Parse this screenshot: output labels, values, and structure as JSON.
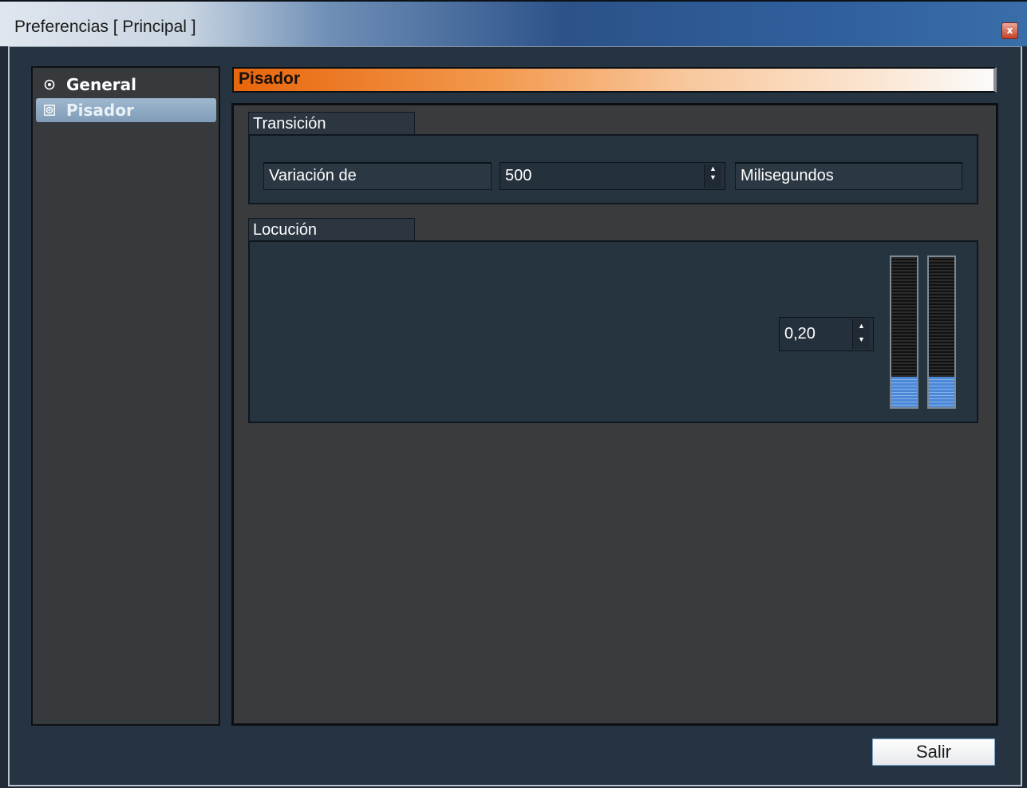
{
  "window": {
    "title": "Preferencias [ Principal ]",
    "close_label": "x"
  },
  "sidebar": {
    "items": [
      {
        "label": "General",
        "selected": false
      },
      {
        "label": "Pisador",
        "selected": true
      }
    ]
  },
  "section": {
    "title": "Pisador"
  },
  "transicion": {
    "group_label": "Transición",
    "variacion_label": "Variación de",
    "value": "500",
    "unit_label": "Milisegundos"
  },
  "locucion": {
    "group_label": "Locución",
    "value": "0,20",
    "meters": [
      {
        "level": 0.2
      },
      {
        "level": 0.2
      }
    ]
  },
  "footer": {
    "exit_label": "Salir"
  },
  "colors": {
    "accent_orange": "#e8660c",
    "selected_item": "#8fa9c3",
    "meter_blue": "#4d88d6"
  }
}
